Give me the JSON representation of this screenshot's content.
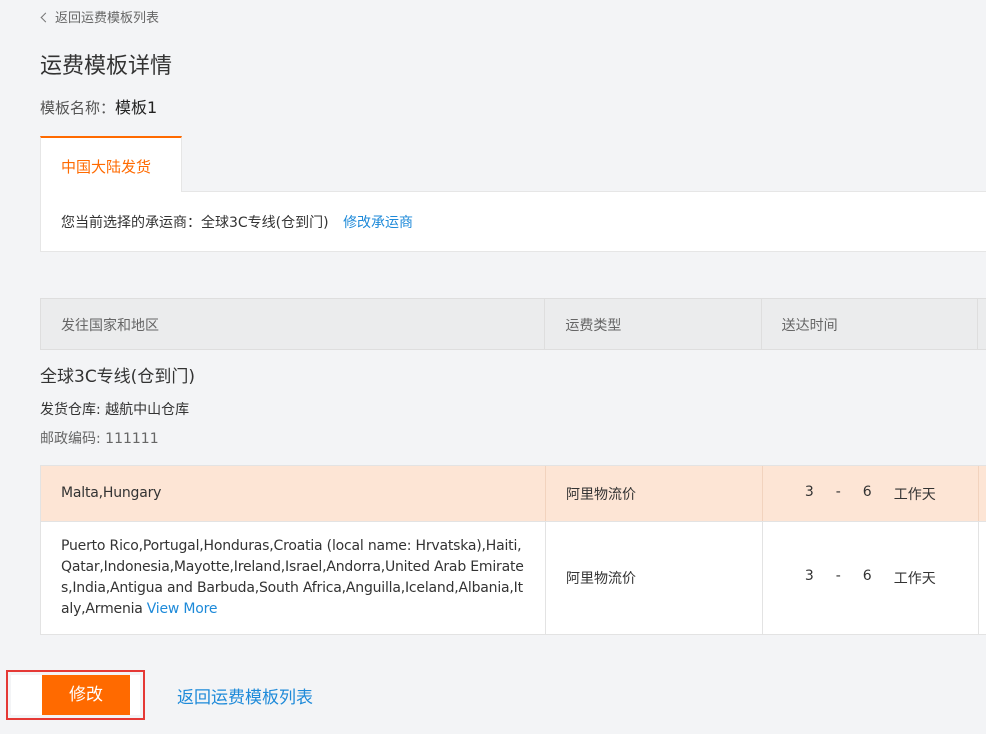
{
  "back_link": "返回运费模板列表",
  "page_title": "运费模板详情",
  "template": {
    "label": "模板名称：",
    "name": "模板1"
  },
  "tab_label": "中国大陆发货",
  "carrier": {
    "label": "您当前选择的承运商：",
    "name": "全球3C专线(仓到门)",
    "change_link": "修改承运商"
  },
  "table": {
    "headers": [
      "发往国家和地区",
      "运费类型",
      "送达时间"
    ],
    "carrier_name": "全球3C专线(仓到门)",
    "warehouse": "发货仓库: 越航中山仓库",
    "zip": "邮政编码: 111111",
    "rows": [
      {
        "countries": "Malta,Hungary",
        "type": "阿里物流价",
        "min": "3",
        "dash": "-",
        "max": "6",
        "unit": "工作天"
      },
      {
        "countries": "Puerto Rico,Portugal,Honduras,Croatia (local name: Hrvatska),Haiti,Qatar,Indonesia,Mayotte,Ireland,Israel,Andorra,United Arab Emirates,India,Antigua and Barbuda,South Africa,Anguilla,Iceland,Albania,Italy,Armenia",
        "view_more": "View More",
        "type": "阿里物流价",
        "min": "3",
        "dash": "-",
        "max": "6",
        "unit": "工作天"
      }
    ]
  },
  "edit_button": "修改",
  "back_bottom": "返回运费模板列表",
  "colors": {
    "accent": "#ff6a00",
    "link": "#1e8ad9",
    "highlight_row": "#fde5d5",
    "callout_border": "#e53935"
  }
}
